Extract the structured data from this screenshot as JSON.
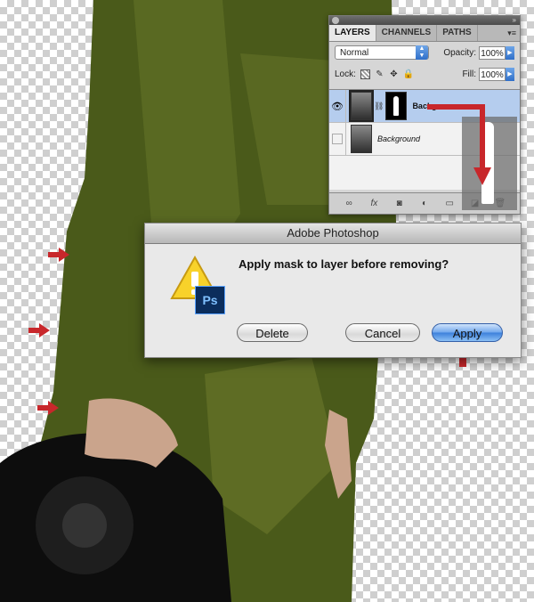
{
  "layers_panel": {
    "tabs": [
      {
        "label": "LAYERS",
        "active": true
      },
      {
        "label": "CHANNELS",
        "active": false
      },
      {
        "label": "PATHS",
        "active": false
      }
    ],
    "blend_mode": "Normal",
    "opacity_label": "Opacity:",
    "opacity_value": "100%",
    "lock_label": "Lock:",
    "fill_label": "Fill:",
    "fill_value": "100%",
    "layers": [
      {
        "name": "Backgr",
        "selected": true,
        "visible": true,
        "has_mask": true
      },
      {
        "name": "Background",
        "selected": false,
        "visible": false,
        "has_mask": false
      }
    ]
  },
  "dialog": {
    "title": "Adobe Photoshop",
    "message": "Apply mask to layer before removing?",
    "icon_text": "Ps",
    "buttons": {
      "delete": "Delete",
      "cancel": "Cancel",
      "apply": "Apply"
    }
  },
  "colors": {
    "annotation_arrow": "#c8272b",
    "default_button": "#3b7fdb",
    "selection": "#b5cdee"
  }
}
